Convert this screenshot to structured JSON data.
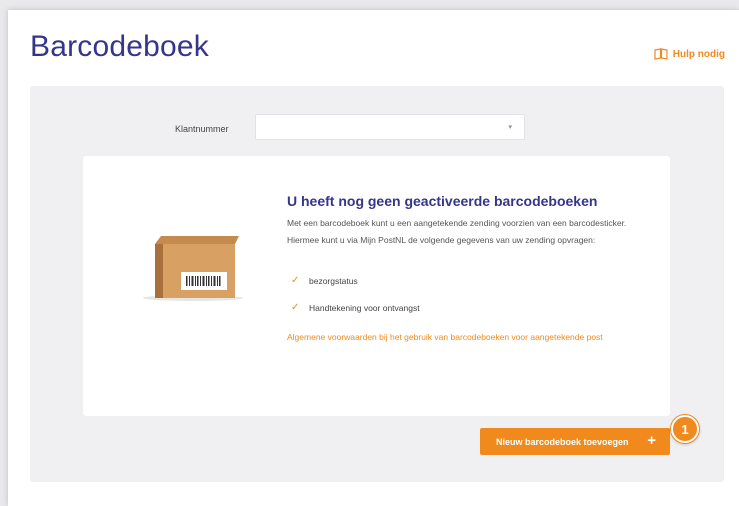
{
  "header": {
    "title": "Barcodeboek",
    "help_label": "Hulp nodig"
  },
  "form": {
    "customer_label": "Klantnummer",
    "customer_value": ""
  },
  "empty_state": {
    "heading": "U heeft nog geen geactiveerde barcodeboeken",
    "description": "Met een barcodeboek kunt u een aangetekende zending voorzien van een barcodesticker. Hiermee kunt u via Mijn PostNL de volgende gegevens van uw zending opvragen:",
    "features": [
      "bezorgstatus",
      "Handtekening voor ontvangst"
    ],
    "terms_link": "Algemene voorwaarden bij het gebruik van barcodeboeken voor aangetekende post"
  },
  "actions": {
    "add_label": "Nieuw barcodeboek toevoegen",
    "add_icon": "plus-icon"
  },
  "callout": {
    "number": "1"
  },
  "colors": {
    "title": "#35358a",
    "accent": "#f08a1c",
    "panel": "#f0f0f3"
  },
  "icons": {
    "help": "help-book-icon",
    "check": "check-icon",
    "select_caret": "chevron-down-icon",
    "illustration": "parcel-box-icon"
  }
}
